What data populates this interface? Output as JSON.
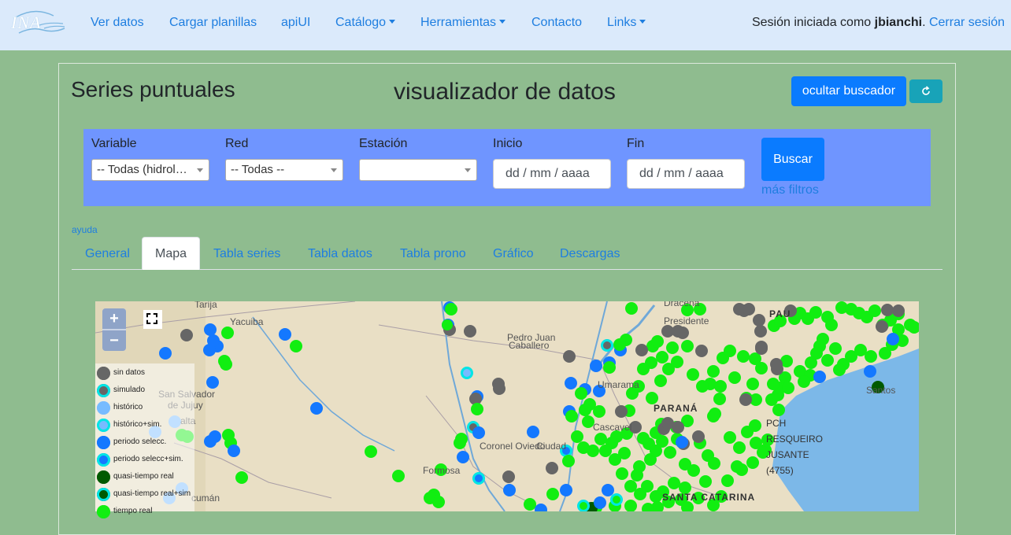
{
  "navbar": {
    "brand": "INA",
    "items": [
      {
        "label": "Ver datos",
        "dropdown": false
      },
      {
        "label": "Cargar planillas",
        "dropdown": false
      },
      {
        "label": "apiUI",
        "dropdown": false
      },
      {
        "label": "Catálogo",
        "dropdown": true
      },
      {
        "label": "Herramientas",
        "dropdown": true
      },
      {
        "label": "Contacto",
        "dropdown": false
      },
      {
        "label": "Links",
        "dropdown": true
      }
    ],
    "session_prefix": "Sesión iniciada como",
    "user": "jbianchi",
    "logout": "Cerrar sesión"
  },
  "header": {
    "series_title": "Series puntuales",
    "viz_title": "visualizador de datos",
    "hide_button": "ocultar buscador",
    "refresh_icon": "refresh-icon"
  },
  "filters": {
    "variable_label": "Variable",
    "variable_value": "-- Todas (hidrológicas) --",
    "red_label": "Red",
    "red_value": "-- Todas --",
    "estacion_label": "Estación",
    "estacion_value": "",
    "inicio_label": "Inicio",
    "inicio_placeholder": "dd / mm / aaaa",
    "fin_label": "Fin",
    "fin_placeholder": "dd / mm / aaaa",
    "search_button": "Buscar",
    "more_filters": "más filtros"
  },
  "help": "ayuda",
  "tabs": {
    "general": "General",
    "mapa": "Mapa",
    "tabla_series": "Tabla series",
    "tabla_datos": "Tabla datos",
    "tabla_prono": "Tabla prono",
    "grafico": "Gráfico",
    "descargas": "Descargas",
    "active": "Mapa"
  },
  "map": {
    "zoom_in": "+",
    "zoom_out": "−",
    "labels": {
      "tarija": "Tarija",
      "yacuiba": "Yacuiba",
      "pedro_juan": "Pedro Juan",
      "caballero": "Caballero",
      "presidente": "Presidente",
      "dracena": "Dracena",
      "umarama": "Umarama",
      "parana": "PARANÁ",
      "cascavel": "Cascavel",
      "coronel_oviedo": "Coronel Oviedo",
      "ciudad": "Ciudad",
      "formosa": "Formosa",
      "san_salvador": "San Salvador",
      "de_jujuy": "de Jujuy",
      "salta": "alta",
      "tucuman": "cumán",
      "santa_catarina": "SANTA CATARINA",
      "santos": "Santos",
      "pau": "PAU",
      "pch1": "PCH",
      "pch2": "RESQUEIRO",
      "pch3": "JUSANTE",
      "pch4": "(4755)"
    },
    "legend": [
      {
        "label": "sin datos",
        "fill": "#666666",
        "ring": "#666666"
      },
      {
        "label": "simulado",
        "fill": "#666666",
        "ring": "#00e5e5"
      },
      {
        "label": "histórico",
        "fill": "#77bbff",
        "ring": "#77bbff"
      },
      {
        "label": "histórico+sim.",
        "fill": "#77bbff",
        "ring": "#00e5e5"
      },
      {
        "label": "periodo selecc.",
        "fill": "#1478ff",
        "ring": "#1478ff"
      },
      {
        "label": "periodo selecc+sim.",
        "fill": "#1478ff",
        "ring": "#00e5e5"
      },
      {
        "label": "quasi-tiempo real",
        "fill": "#005a00",
        "ring": "#005a00"
      },
      {
        "label": "quasi-tiempo real+sim",
        "fill": "#005a00",
        "ring": "#00e5e5"
      },
      {
        "label": "tiempo real",
        "fill": "#11ee11",
        "ring": "#11ee11"
      }
    ]
  }
}
